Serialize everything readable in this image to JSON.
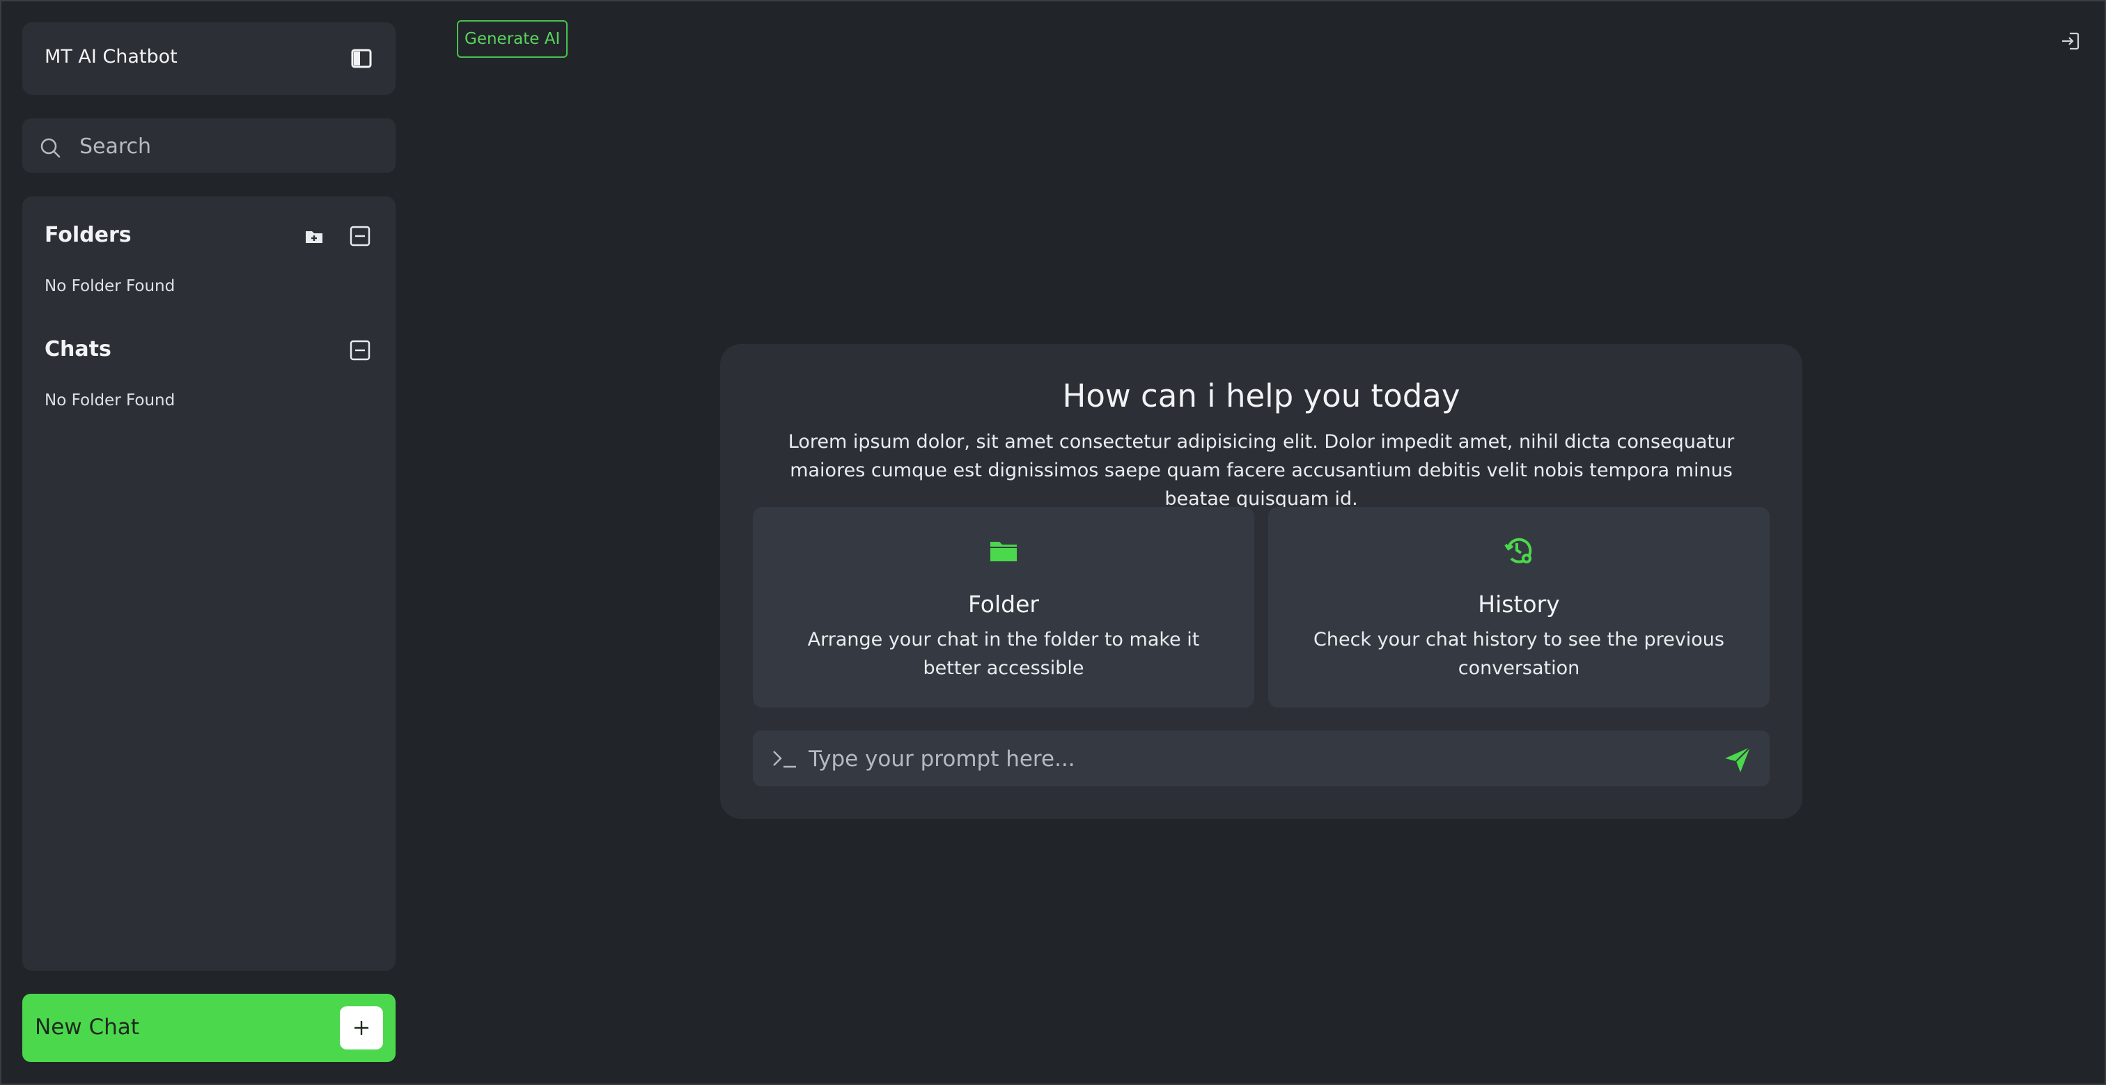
{
  "app": {
    "title": "MT AI Chatbot"
  },
  "search": {
    "placeholder": "Search"
  },
  "sidebar": {
    "folders": {
      "title": "Folders",
      "empty": "No Folder Found"
    },
    "chats": {
      "title": "Chats",
      "empty": "No Folder Found"
    },
    "new_chat_label": "New Chat"
  },
  "topbar": {
    "generate_label": "Generate AI"
  },
  "main": {
    "title": "How can i help you today",
    "description": "Lorem ipsum dolor, sit amet consectetur adipisicing elit. Dolor impedit amet, nihil dicta consequatur maiores cumque est dignissimos saepe quam facere accusantium debitis velit nobis tempora minus beatae quisquam id.",
    "features": [
      {
        "title": "Folder",
        "description": "Arrange your chat in the folder to make it better accessible",
        "icon": "folder-icon"
      },
      {
        "title": "History",
        "description": "Check your chat history to see the previous conversation",
        "icon": "history-settings-icon"
      }
    ],
    "prompt_placeholder": "Type your prompt here..."
  },
  "colors": {
    "accent": "#4cd84c",
    "background": "#212529",
    "panel": "#2c3036",
    "card": "#353a42"
  },
  "icons": [
    "sidebar-toggle-icon",
    "search-icon",
    "folder-add-icon",
    "collapse-icon",
    "plus-icon",
    "logout-icon",
    "folder-icon",
    "history-settings-icon",
    "terminal-icon",
    "send-icon"
  ]
}
